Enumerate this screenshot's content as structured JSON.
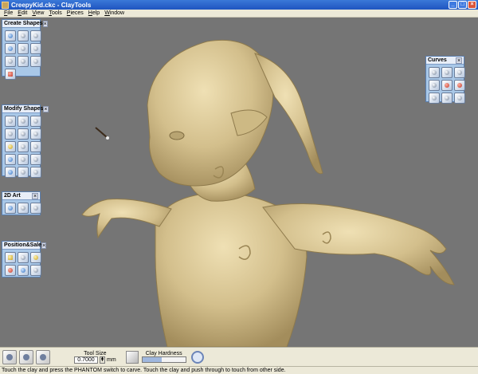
{
  "window": {
    "title": "CreepyKid.ckc - ClayTools",
    "minimize": "_",
    "maximize": "□",
    "close": "×"
  },
  "menu": [
    {
      "key": "F",
      "rest": "ile"
    },
    {
      "key": "E",
      "rest": "dit"
    },
    {
      "key": "V",
      "rest": "iew"
    },
    {
      "key": "T",
      "rest": "ools"
    },
    {
      "key": "P",
      "rest": "ieces"
    },
    {
      "key": "H",
      "rest": "elp"
    },
    {
      "key": "W",
      "rest": "indow"
    }
  ],
  "panels": {
    "create_shapes": {
      "title": "Create Shapes"
    },
    "modify_shapes": {
      "title": "Modify Shapes"
    },
    "art_2d": {
      "title": "2D Art"
    },
    "position_scale": {
      "title": "Position&Sale"
    },
    "curves": {
      "title": "Curves"
    }
  },
  "toolbar": {
    "tool_size_label": "Tool Size",
    "tool_size_value": "0.7000",
    "tool_size_unit": "mm",
    "clay_hardness_label": "Clay Hardness",
    "clay_hardness_level": 0.45
  },
  "status": "Touch the clay and press the PHANTOM switch to carve. Touch the clay and push through to touch from other side.",
  "colors": {
    "viewport": "#757575",
    "clay": "#d8c596",
    "panel": "#a9c8e8"
  }
}
